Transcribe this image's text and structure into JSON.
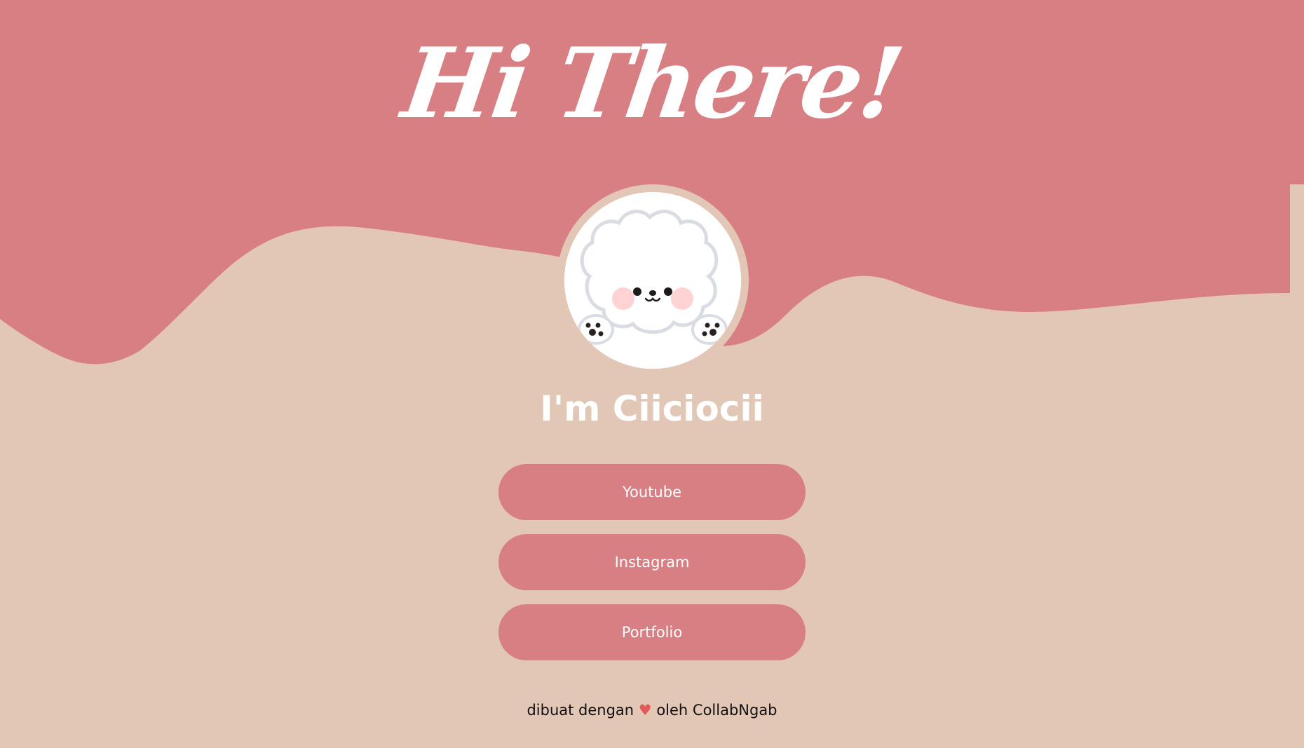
{
  "header": {
    "title": "Hi There!"
  },
  "profile": {
    "avatar_icon": "fluffy-puppy-icon",
    "name": "I'm Ciiciocii"
  },
  "links": [
    {
      "label": "Youtube"
    },
    {
      "label": "Instagram"
    },
    {
      "label": "Portfolio"
    }
  ],
  "footer": {
    "prefix": "dibuat dengan",
    "heart": "♥",
    "suffix": "oleh CollabNgab"
  },
  "colors": {
    "primary": "#d87f83",
    "background": "#e2c6b6",
    "text_light": "#ffffff",
    "heart": "#e25a5a"
  }
}
